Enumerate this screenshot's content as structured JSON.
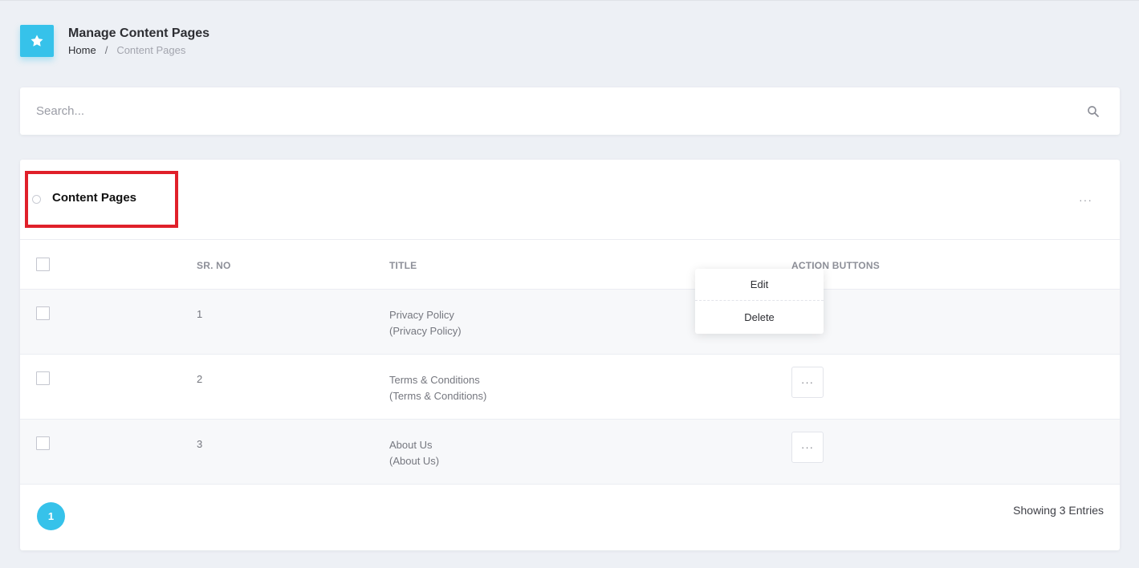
{
  "header": {
    "title": "Manage Content Pages",
    "breadcrumb": {
      "home": "Home",
      "separator": "/",
      "current": "Content Pages"
    },
    "icon": "star-icon",
    "accent_color": "#36c2ea"
  },
  "search": {
    "placeholder": "Search...",
    "value": "",
    "icon": "search-icon"
  },
  "card": {
    "title": "Content Pages",
    "menu_label": "···",
    "highlight_color": "#e0202a"
  },
  "table": {
    "columns": [
      "",
      "SR. NO",
      "TITLE",
      "ACTION BUTTONS"
    ],
    "rows": [
      {
        "sr_no": "1",
        "title": "Privacy Policy",
        "subtitle": "(Privacy Policy)"
      },
      {
        "sr_no": "2",
        "title": "Terms & Conditions",
        "subtitle": "(Terms & Conditions)"
      },
      {
        "sr_no": "3",
        "title": "About Us",
        "subtitle": "(About Us)"
      }
    ],
    "action_label": "···"
  },
  "dropdown": {
    "items": [
      "Edit",
      "Delete"
    ]
  },
  "footer": {
    "current_page": "1",
    "entries_text": "Showing 3 Entries"
  }
}
